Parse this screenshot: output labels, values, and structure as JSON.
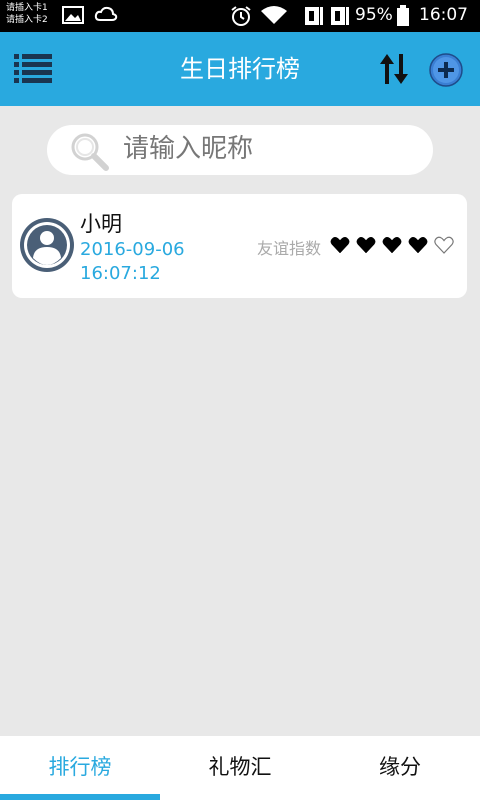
{
  "status_bar": {
    "sim1": "请插入卡1",
    "sim2": "请插入卡2",
    "battery": "95%",
    "time": "16:07"
  },
  "header": {
    "title": "生日排行榜",
    "menu_icon": "list-menu-icon",
    "sort_icon": "sort-up-down-icon",
    "add_icon": "plus-circle-icon"
  },
  "search": {
    "placeholder": "请输入昵称",
    "icon": "magnifier-icon"
  },
  "friends": [
    {
      "name": "小明",
      "date": "2016-09-06",
      "time": "16:07:12",
      "friendship_label": "友谊指数",
      "friendship_rating": 4,
      "friendship_max": 5
    }
  ],
  "tabs": [
    {
      "label": "排行榜",
      "active": true
    },
    {
      "label": "礼物汇",
      "active": false
    },
    {
      "label": "缘分",
      "active": false
    }
  ],
  "colors": {
    "accent": "#29a9df",
    "background": "#e8e8e8",
    "card": "#ffffff"
  }
}
